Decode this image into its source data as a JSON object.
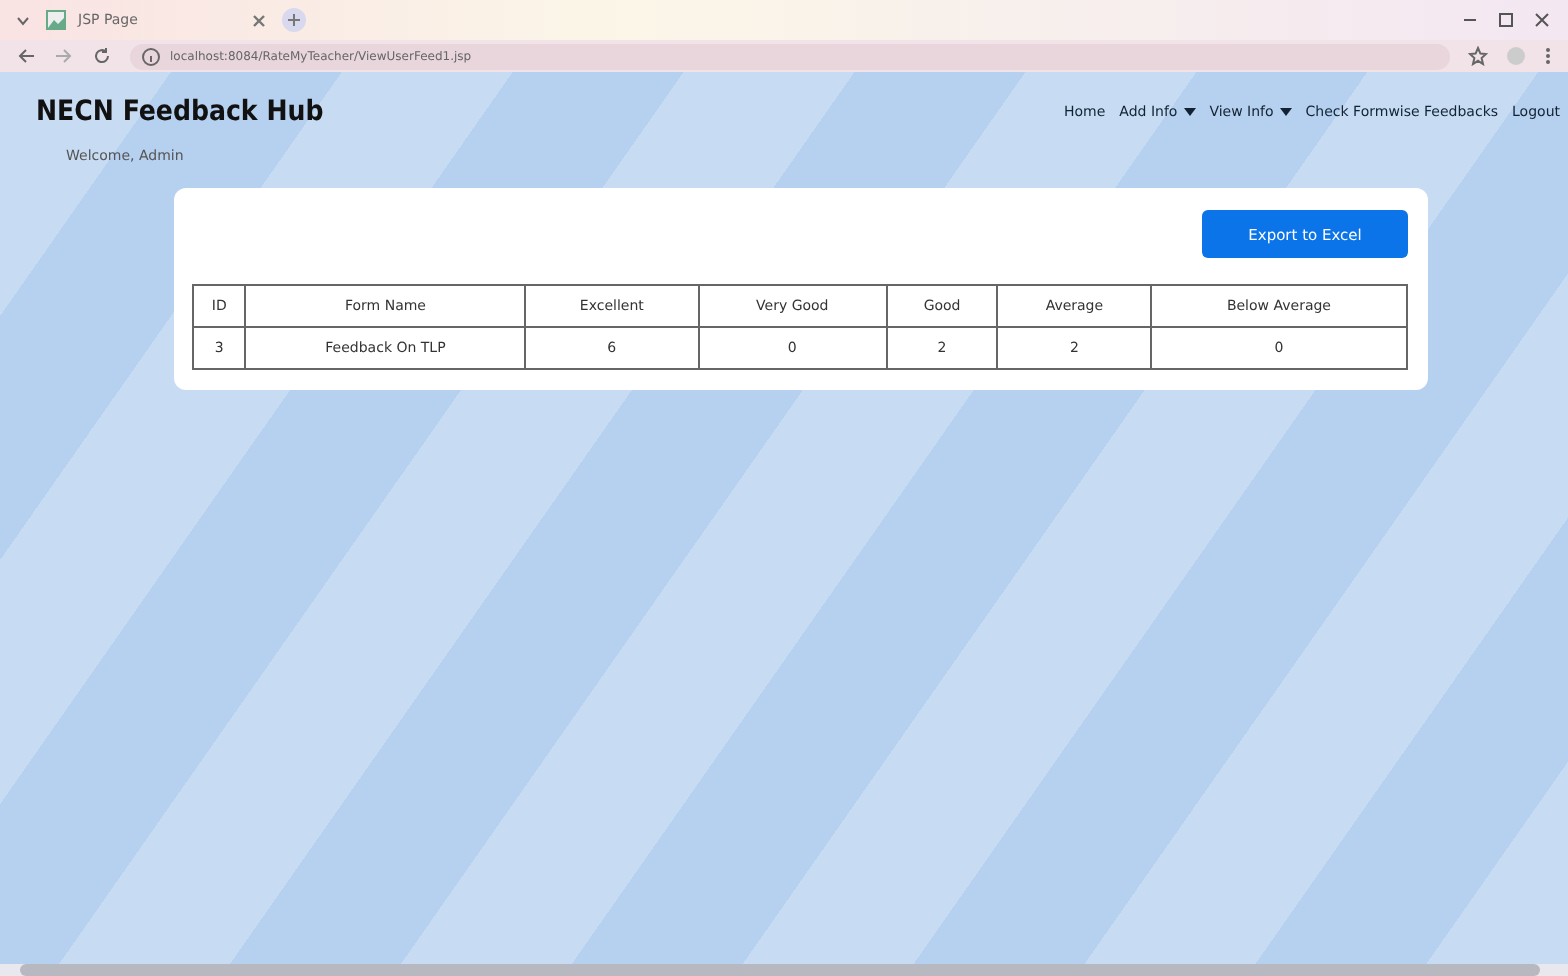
{
  "browser": {
    "tab_title": "JSP Page",
    "url": "localhost:8084/RateMyTeacher/ViewUserFeed1.jsp"
  },
  "navbar": {
    "brand": "NECN Feedback Hub",
    "links": [
      {
        "label": "Home",
        "dropdown": false
      },
      {
        "label": "Add Info",
        "dropdown": true
      },
      {
        "label": "View Info",
        "dropdown": true
      },
      {
        "label": "Check Formwise Feedbacks",
        "dropdown": false
      },
      {
        "label": "Logout",
        "dropdown": false
      }
    ]
  },
  "welcome": "Welcome, Admin",
  "export_button": "Export to Excel",
  "table": {
    "columns": [
      "ID",
      "Form Name",
      "Excellent",
      "Very Good",
      "Good",
      "Average",
      "Below Average"
    ],
    "rows": [
      [
        "3",
        "Feedback On TLP",
        "6",
        "0",
        "2",
        "2",
        "0"
      ]
    ]
  }
}
